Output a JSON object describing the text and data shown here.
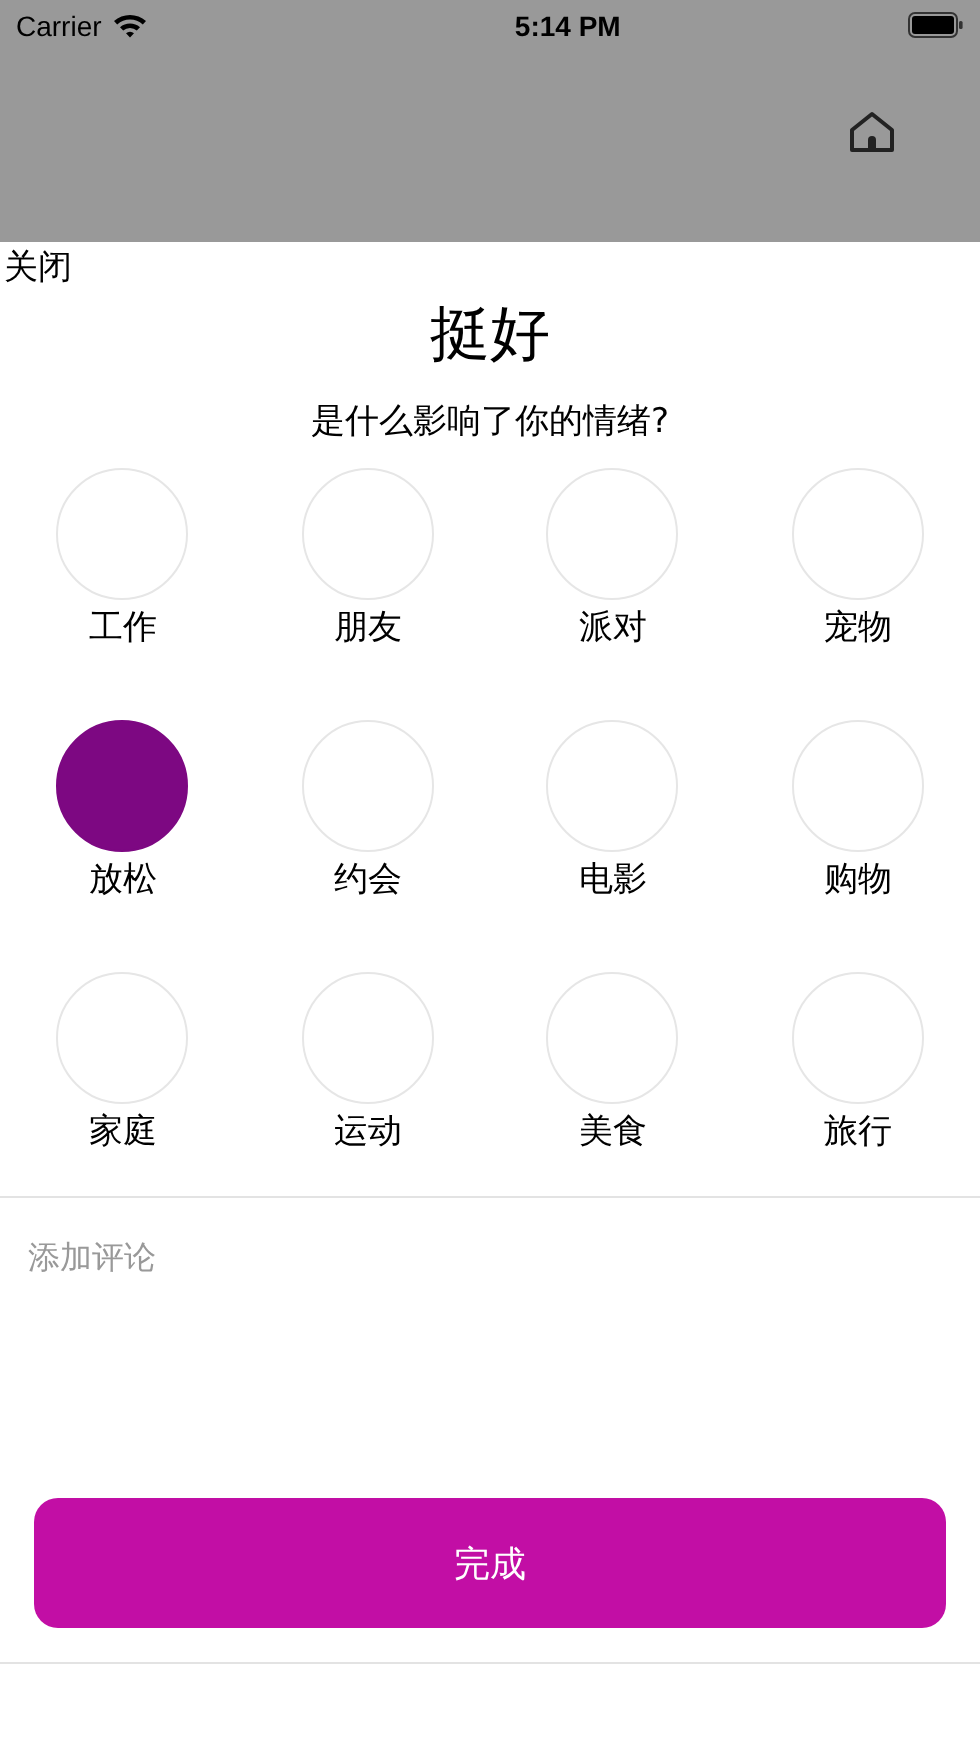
{
  "status_bar": {
    "carrier": "Carrier",
    "time": "5:14 PM"
  },
  "close": "关闭",
  "title": "挺好",
  "question": "是什么影响了你的情绪?",
  "categories": [
    {
      "label": "工作",
      "selected": false
    },
    {
      "label": "朋友",
      "selected": false
    },
    {
      "label": "派对",
      "selected": false
    },
    {
      "label": "宠物",
      "selected": false
    },
    {
      "label": "放松",
      "selected": true
    },
    {
      "label": "约会",
      "selected": false
    },
    {
      "label": "电影",
      "selected": false
    },
    {
      "label": "购物",
      "selected": false
    },
    {
      "label": "家庭",
      "selected": false
    },
    {
      "label": "运动",
      "selected": false
    },
    {
      "label": "美食",
      "selected": false
    },
    {
      "label": "旅行",
      "selected": false
    }
  ],
  "comment": {
    "placeholder": "添加评论"
  },
  "done_button": "完成"
}
